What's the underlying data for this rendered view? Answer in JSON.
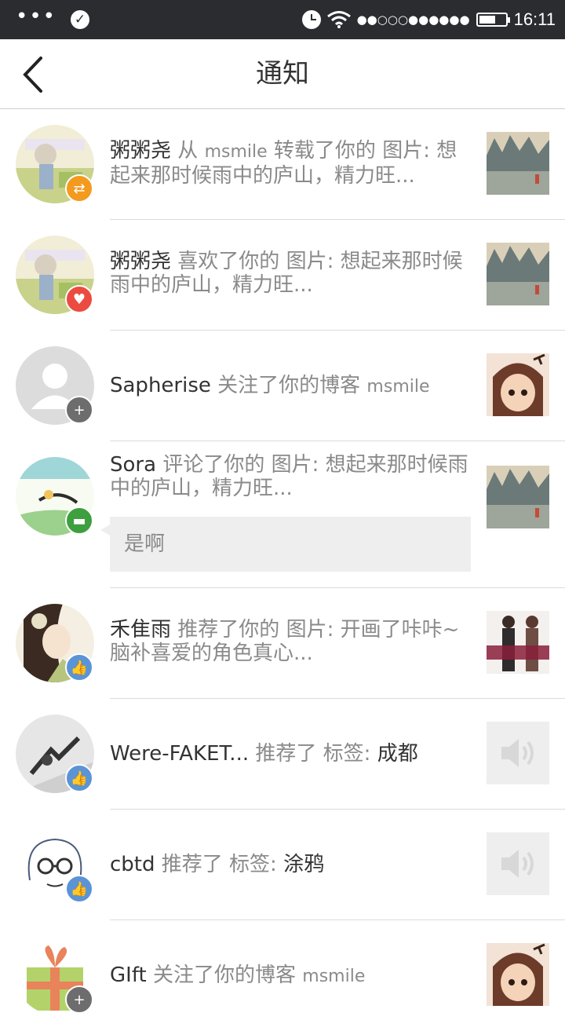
{
  "status_bar": {
    "time": "16:11",
    "signal": "●●○○○●●●●●●"
  },
  "header": {
    "title": "通知"
  },
  "notifications": [
    {
      "name": "粥粥尧",
      "action": "从",
      "target_user": "msmile",
      "action2": "转载了你的",
      "type": "图片:",
      "content": "想起来那时候雨中的庐山，精力旺...",
      "badge": "repost-icon",
      "badge_color": "#f39a1f"
    },
    {
      "name": "粥粥尧",
      "action": "喜欢了你的",
      "type": "图片:",
      "content": "想起来那时候雨中的庐山，精力旺...",
      "badge": "heart-icon",
      "badge_color": "#ec4b41"
    },
    {
      "name": "Sapherise",
      "action": "关注了你的博客",
      "target_user": "msmile",
      "badge": "plus-icon",
      "badge_color": "#6d6d6d"
    },
    {
      "name": "Sora",
      "action": "评论了你的",
      "type": "图片:",
      "content": "想起来那时候雨中的庐山，精力旺...",
      "comment": "是啊",
      "badge": "comment-icon",
      "badge_color": "#3e9f3f"
    },
    {
      "name": "禾隹雨",
      "action": "推荐了你的",
      "type": "图片:",
      "content": "开画了咔咔~脑补喜爱的角色真心...",
      "badge": "thumb-up-icon",
      "badge_color": "#5b94d6"
    },
    {
      "name": "Were-FAKET...",
      "action": "推荐了",
      "type": "标签:",
      "tag": "成都",
      "badge": "thumb-up-icon",
      "badge_color": "#5b94d6"
    },
    {
      "name": "cbtd",
      "action": "推荐了",
      "type": "标签:",
      "tag": "涂鸦",
      "badge": "thumb-up-icon",
      "badge_color": "#5b94d6"
    },
    {
      "name": "GIft",
      "action": "关注了你的博客",
      "target_user": "msmile",
      "badge": "plus-icon",
      "badge_color": "#6d6d6d"
    }
  ]
}
